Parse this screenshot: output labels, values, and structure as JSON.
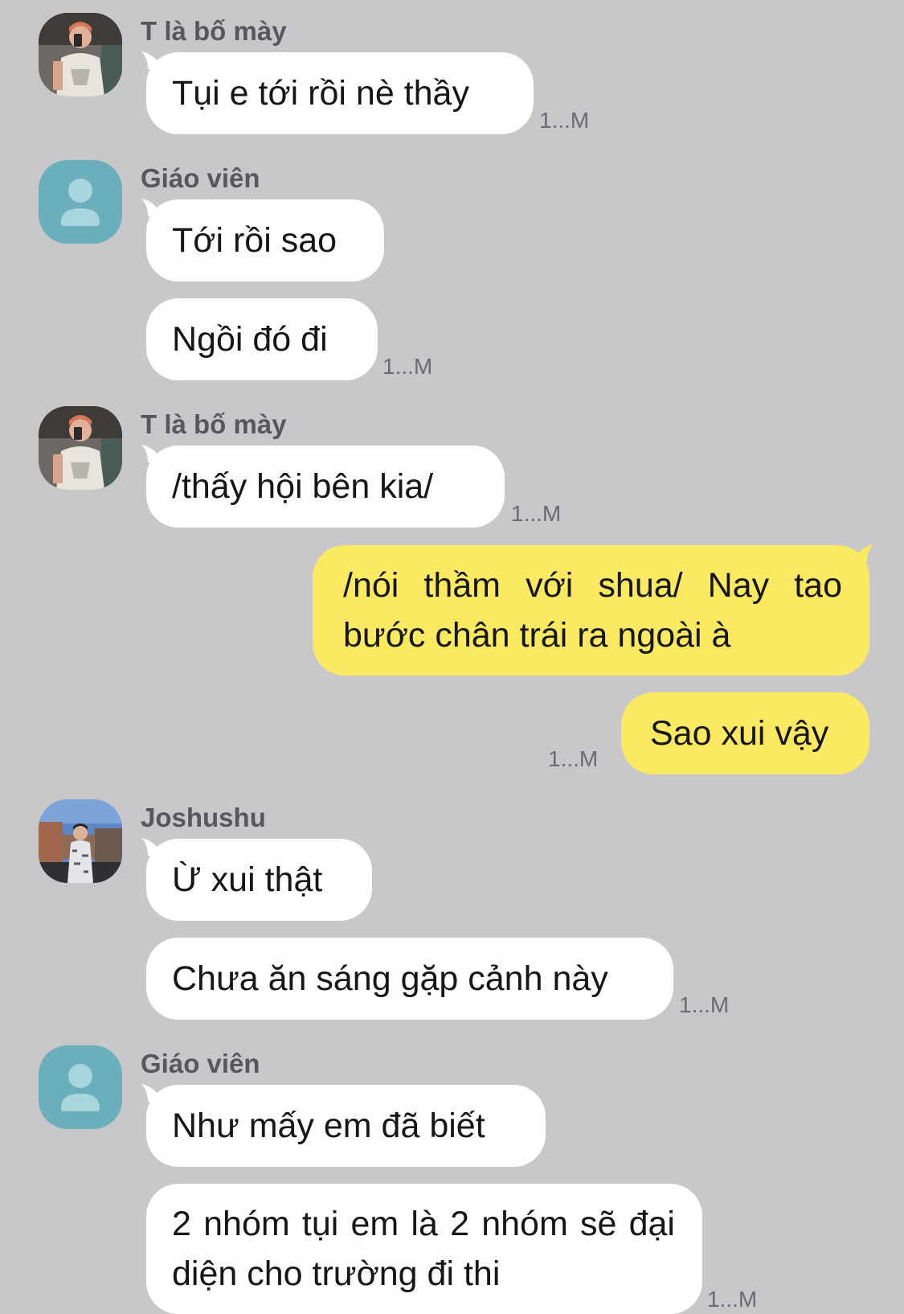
{
  "senders": {
    "t_la_bo_may": "T là bố mày",
    "giao_vien": "Giáo viên",
    "joshushu": "Joshushu"
  },
  "messages": [
    {
      "sender": "T là bố mày",
      "text": "Tụi e tới rồi nè thầy",
      "time": "1...M"
    },
    {
      "sender": "Giáo viên",
      "text": "Tới rồi sao"
    },
    {
      "sender": "Giáo viên",
      "text": "Ngồi đó đi",
      "time": "1...M"
    },
    {
      "sender": "T là bố mày",
      "text": "/thấy hội bên kia/",
      "time": "1...M"
    },
    {
      "sender": "me",
      "text": "/nói thầm với shua/ Nay tao bước chân trái ra ngoài à"
    },
    {
      "sender": "me",
      "text": "Sao xui vậy",
      "time": "1...M"
    },
    {
      "sender": "Joshushu",
      "text": "Ừ xui thật"
    },
    {
      "sender": "Joshushu",
      "text": "Chưa ăn sáng gặp cảnh này",
      "time": "1...M"
    },
    {
      "sender": "Giáo viên",
      "text": "Như mấy em đã biết"
    },
    {
      "sender": "Giáo viên",
      "text": "2 nhóm tụi em là 2 nhóm sẽ đại diện cho trường đi thi",
      "time": "1...M"
    }
  ],
  "icons": {
    "avatar_t_la_bo_may": "person-photo-avatar",
    "avatar_giao_vien": "default-person-avatar",
    "avatar_joshushu": "person-photo-avatar"
  },
  "colors": {
    "background": "#c8c8ca",
    "incoming_bubble": "#ffffff",
    "outgoing_bubble": "#fbe962",
    "default_avatar": "#6aafbb",
    "sender_name": "#55585f",
    "timestamp": "#6a6c72"
  }
}
